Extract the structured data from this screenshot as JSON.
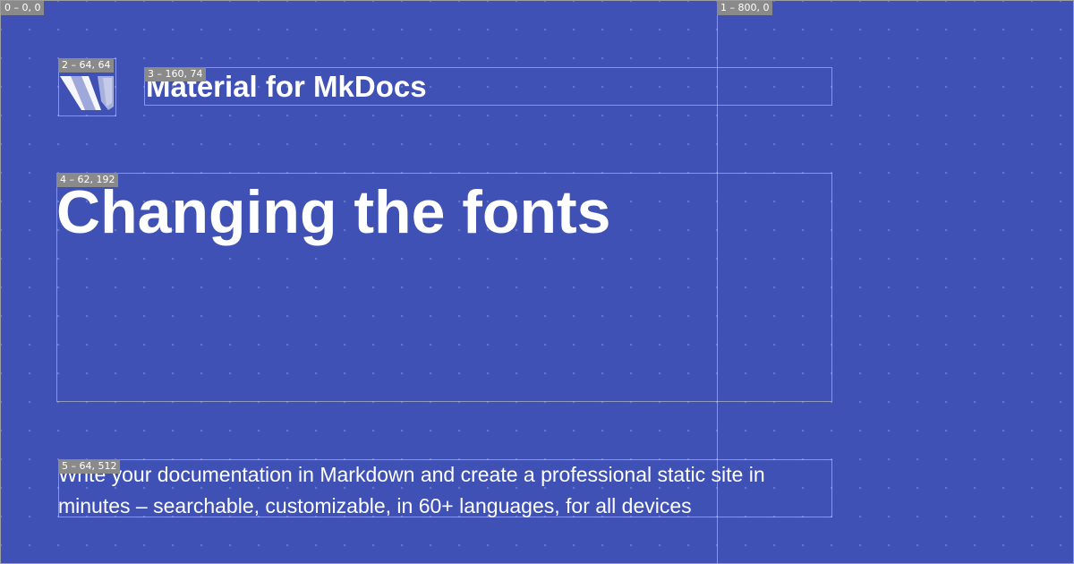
{
  "site": {
    "name": "Material for MkDocs"
  },
  "page": {
    "title": "Changing the fonts",
    "description": "Write your documentation in Markdown and create a professional static site in minutes – searchable, customizable, in 60+ languages, for all devices"
  },
  "debug_labels": [
    "0 – 0, 0",
    "1 – 800, 0",
    "2 – 64, 64",
    "3 – 160, 74",
    "4 – 62, 192",
    "5 – 64, 512"
  ],
  "colors": {
    "background": "#3f51b5",
    "foreground": "#ffffff",
    "guide": "#c8c8c8"
  },
  "icons": {
    "logo": "material-logo-icon"
  }
}
